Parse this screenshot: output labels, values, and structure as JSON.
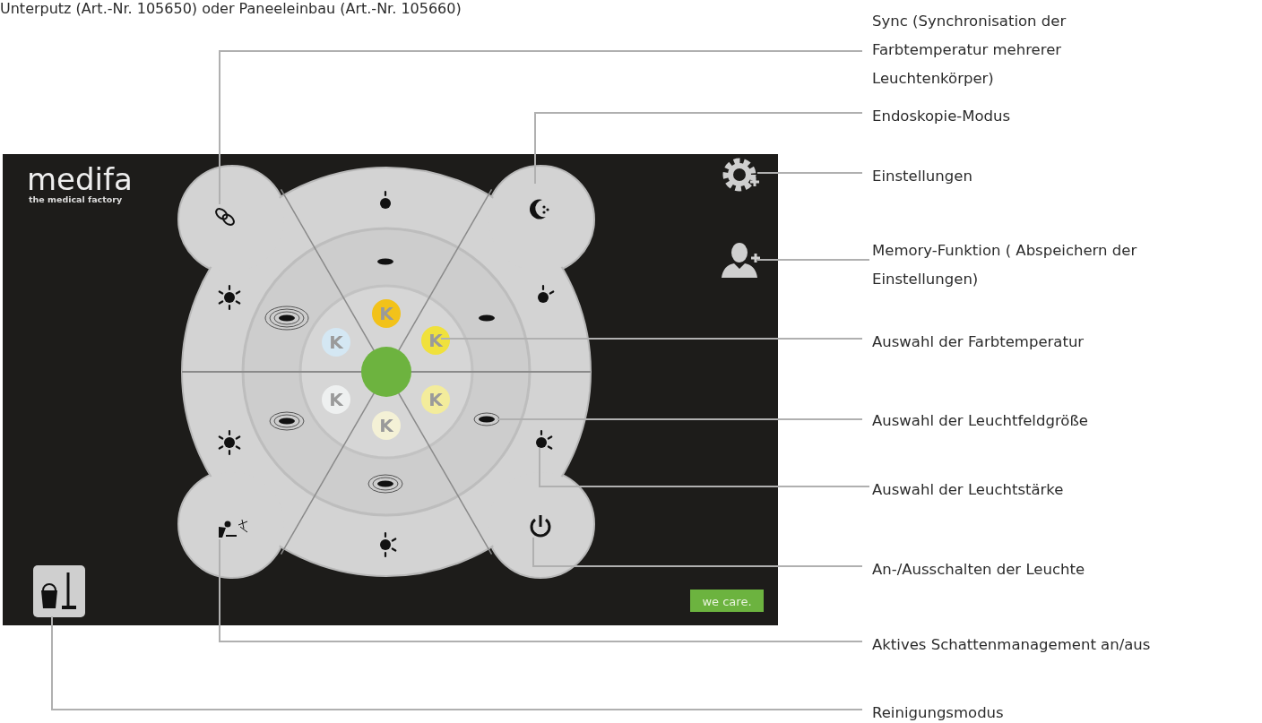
{
  "header_text": "Unterputz (Art.-Nr. 105650)  oder Paneeleinbau (Art.-Nr. 105660)",
  "screen": {
    "logo": {
      "name": "medifa",
      "tagline": "the medical factory"
    },
    "color_temperatures": [
      {
        "label": "K",
        "color": "#f2c21a"
      },
      {
        "label": "K",
        "color": "#f0e13c"
      },
      {
        "label": "K",
        "color": "#f3ec9c"
      },
      {
        "label": "K",
        "color": "#f4f1d6"
      },
      {
        "label": "K",
        "color": "#eef0f0"
      },
      {
        "label": "K",
        "color": "#d4e7f3"
      }
    ],
    "badge": "we care."
  },
  "callouts": [
    {
      "lines": [
        "Sync (Synchronisation der",
        "Farbtemperatur mehrerer",
        "Leuchtenkörper)"
      ]
    },
    {
      "lines": [
        "Endoskopie-Modus"
      ]
    },
    {
      "lines": [
        "Einstellungen"
      ]
    },
    {
      "lines": [
        "Memory-Funktion ( Abspeichern der",
        "Einstellungen)"
      ]
    },
    {
      "lines": [
        "Auswahl der Farbtemperatur"
      ]
    },
    {
      "lines": [
        "Auswahl der Leuchtfeldgröße"
      ]
    },
    {
      "lines": [
        "Auswahl der Leuchtstärke"
      ]
    },
    {
      "lines": [
        "An-/Ausschalten der Leuchte"
      ]
    },
    {
      "lines": [
        "Aktives Schattenmanagement an/aus"
      ]
    },
    {
      "lines": [
        "Reinigungsmodus"
      ]
    }
  ]
}
